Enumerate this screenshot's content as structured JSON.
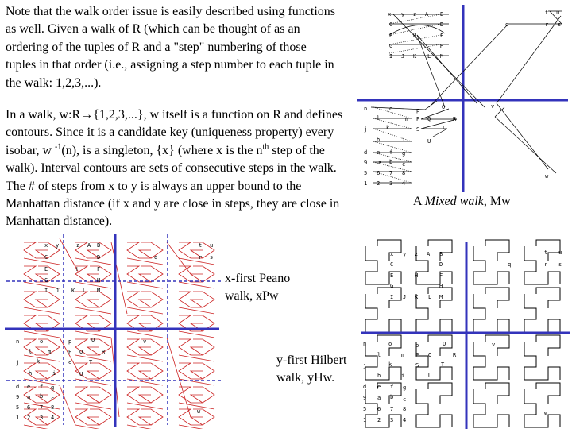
{
  "paragraphs": {
    "intro": "Note that the walk order issue is easily described using functions as well.  Given a walk of R (which can be thought of as an ordering of the tuples of R and a \"step\" numbering of those tuples in that order (i.e., assigning a step number to each tuple in the walk: 1,2,3,...).",
    "contours_a": "In a walk, w:R→{1,2,3,...}, w itself is a function on R and defines contours.  Since it is a candidate key (uniqueness property) every isobar, w ",
    "contours_sup1": "-1",
    "contours_b": "(n),  is a singleton, {x} (where x is the n",
    "contours_sup2": "th",
    "contours_c": " step of the walk).   Interval contours are sets of consecutive steps in the walk. The # of steps from x to y is always an upper bound to the Manhattan distance (if x and y are close in steps, they are close in Manhattan distance)."
  },
  "captions": {
    "mixed_a": "A ",
    "mixed_italic": "Mixed walk",
    "mixed_b": ", Mw",
    "peano_line1": "x-first Peano",
    "peano_line2": "walk, xPw",
    "hilbert_line1": "y-first Hilbert",
    "hilbert_line2": "walk, yHw."
  },
  "colors": {
    "axis": "#3333bb",
    "peano_path": "#cc2222",
    "path": "#000000"
  },
  "diagrams": {
    "mixed_walk": {
      "labels_top_left": [
        "x",
        "y",
        "z",
        "A",
        "B",
        "C",
        "D",
        "E",
        "F",
        "G",
        "H",
        "I",
        "J",
        "K",
        "L",
        "M"
      ],
      "labels_top_right": [
        "t",
        "u",
        "q",
        "r",
        "s"
      ],
      "labels_bottom_left": [
        "n",
        "o",
        "l",
        "m",
        "j",
        "k",
        "h",
        "i",
        "d",
        "e",
        "f",
        "g",
        "9",
        "a",
        "b",
        "c",
        "5",
        "6",
        "7",
        "8",
        "1",
        "2",
        "3",
        "4"
      ],
      "labels_bottom_mid": [
        "p",
        "O",
        "P",
        "Q",
        "R",
        "S",
        "T",
        "U"
      ],
      "labels_bottom_right": [
        "v",
        "w"
      ]
    },
    "peano_walk": {
      "labels": [
        "x",
        "y",
        "z",
        "A",
        "B",
        "C",
        "D",
        "E",
        "F",
        "G",
        "H",
        "I",
        "J",
        "K",
        "L",
        "M",
        "t",
        "u",
        "q",
        "r",
        "s",
        "n",
        "o",
        "l",
        "m",
        "j",
        "k",
        "h",
        "i",
        "p",
        "O",
        "P",
        "Q",
        "R",
        "S",
        "T",
        "U",
        "v",
        "w",
        "d",
        "e",
        "f",
        "g",
        "9",
        "a",
        "b",
        "c",
        "5",
        "6",
        "7",
        "8",
        "1",
        "2",
        "3",
        "4"
      ]
    },
    "hilbert_walk": {
      "labels": [
        "x",
        "y",
        "z",
        "A",
        "B",
        "C",
        "D",
        "E",
        "F",
        "G",
        "H",
        "I",
        "J",
        "K",
        "L",
        "M",
        "t",
        "u",
        "q",
        "r",
        "s",
        "n",
        "o",
        "l",
        "m",
        "p",
        "O",
        "P",
        "Q",
        "R",
        "j",
        "k",
        "S",
        "T",
        "h",
        "i",
        "U",
        "v",
        "d",
        "e",
        "f",
        "g",
        "9",
        "a",
        "b",
        "c",
        "5",
        "6",
        "7",
        "8",
        "1",
        "2",
        "3",
        "4",
        "w"
      ]
    }
  }
}
